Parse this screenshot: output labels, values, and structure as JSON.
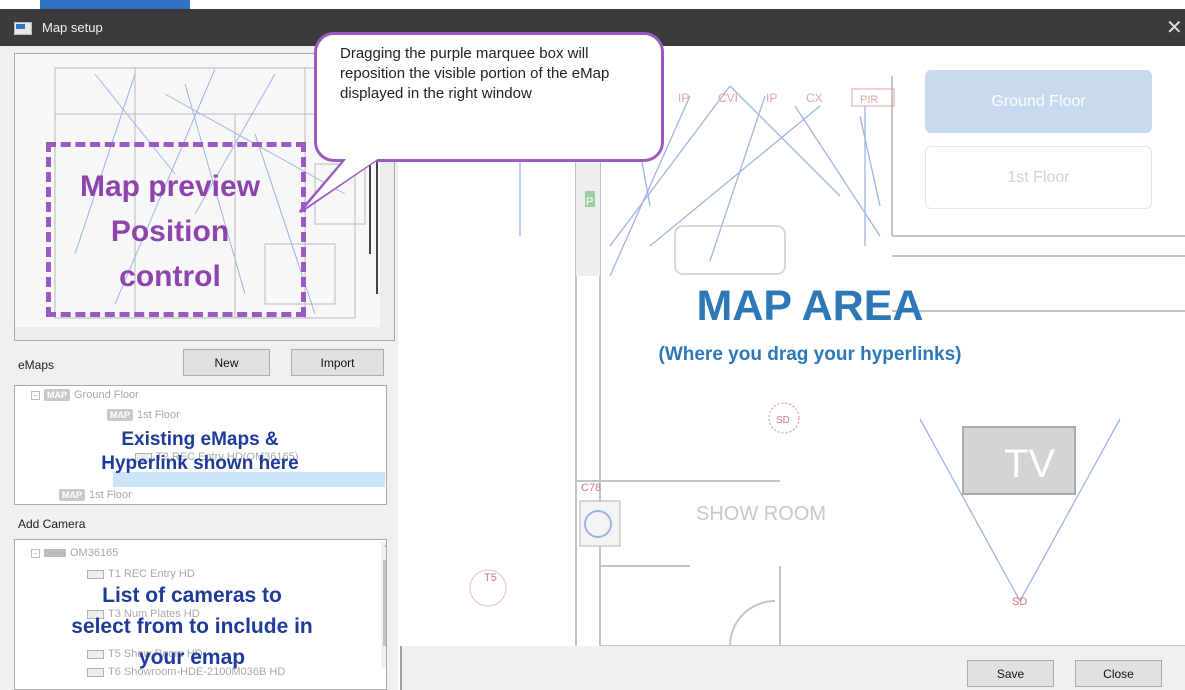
{
  "window": {
    "title": "Map setup",
    "close_glyph": "✕"
  },
  "preview": {
    "annotation": "Map preview Position control",
    "annotation_lines": [
      "Map preview",
      "Position",
      "control"
    ]
  },
  "callout": {
    "text": "Dragging the purple marquee box will reposition the visible portion of the eMap displayed in the right window"
  },
  "emaps": {
    "label": "eMaps",
    "new_button": "New",
    "import_button": "Import",
    "tree": [
      {
        "badge": "MAP",
        "text": "Ground Floor"
      },
      {
        "badge": "MAP",
        "text": "1st Floor"
      },
      {
        "badge": "",
        "text": "T2 REC Entry HD(OM36165)"
      },
      {
        "badge": "MAP",
        "text": "1st Floor"
      }
    ],
    "annotation_lines": [
      "Existing eMaps &",
      "Hyperlink shown here"
    ]
  },
  "add_camera": {
    "label": "Add Camera",
    "tree": [
      {
        "text": "OM36165"
      },
      {
        "text": "T1 REC Entry HD"
      },
      {
        "text": "T3 Num Plates HD"
      },
      {
        "text": "T5 Show Room HD"
      },
      {
        "text": "T6 Showroom-HDE-2100M036B HD"
      }
    ],
    "annotation_lines": [
      "List of cameras to",
      "select from to include in",
      "your emap"
    ]
  },
  "map": {
    "title": "MAP AREA",
    "subtitle": "(Where you drag your hyperlinks)",
    "floor_buttons": [
      "Ground Floor",
      "1st Floor"
    ],
    "labels": {
      "ip1": "IP",
      "cvi": "CVI",
      "ip2": "IP",
      "cx": "CX",
      "pir": "PIR",
      "sd1": "SD",
      "sd2": "SD",
      "c78": "C78",
      "t5": "T5",
      "tv": "TV",
      "showroom": "SHOW ROOM",
      "p": "P"
    }
  },
  "footer": {
    "save_button": "Save",
    "close_button": "Close"
  },
  "colors": {
    "accent_purple": "#9b59c4",
    "map_blue": "#2e78b7",
    "annotation_blue": "#1e3a9a",
    "titlebar": "#3b3b3b"
  }
}
